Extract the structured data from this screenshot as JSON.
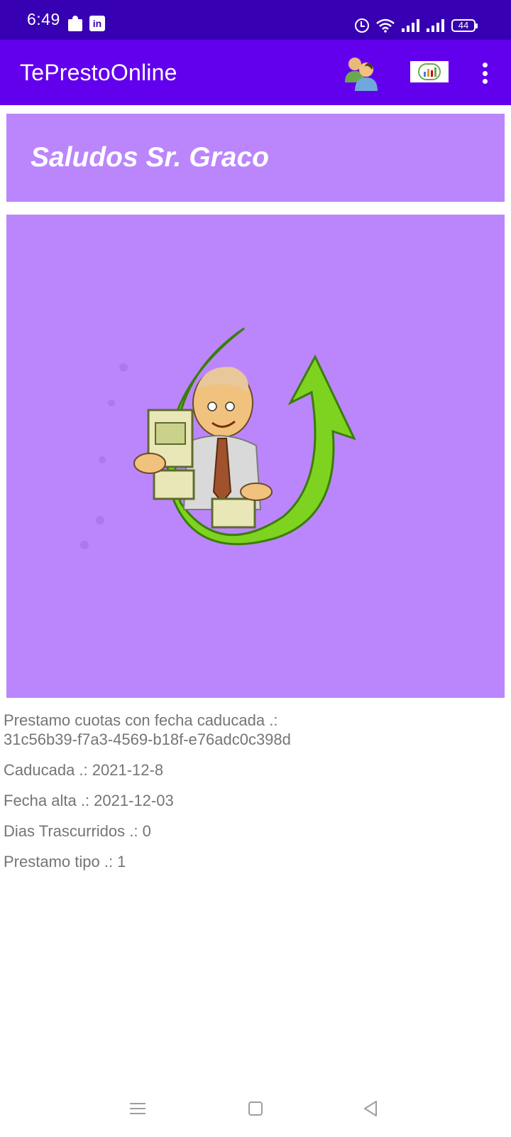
{
  "status_bar": {
    "time": "6:49",
    "battery": "44"
  },
  "app_bar": {
    "title": "TePrestoOnline"
  },
  "greeting": {
    "text": "Saludos Sr. Graco"
  },
  "colors": {
    "status_bar": "#3700b3",
    "app_bar": "#6200ee",
    "card": "#bb86fc",
    "info_text": "#757575"
  },
  "loan": {
    "label": "Prestamo cuotas con fecha caducada .:",
    "id": "31c56b39-f7a3-4569-b18f-e76adc0c398d",
    "expired": "Caducada .: 2021-12-8",
    "created": "Fecha alta .: 2021-12-03",
    "days": "Dias Trascurridos .: 0",
    "type": "Prestamo tipo .: 1"
  }
}
